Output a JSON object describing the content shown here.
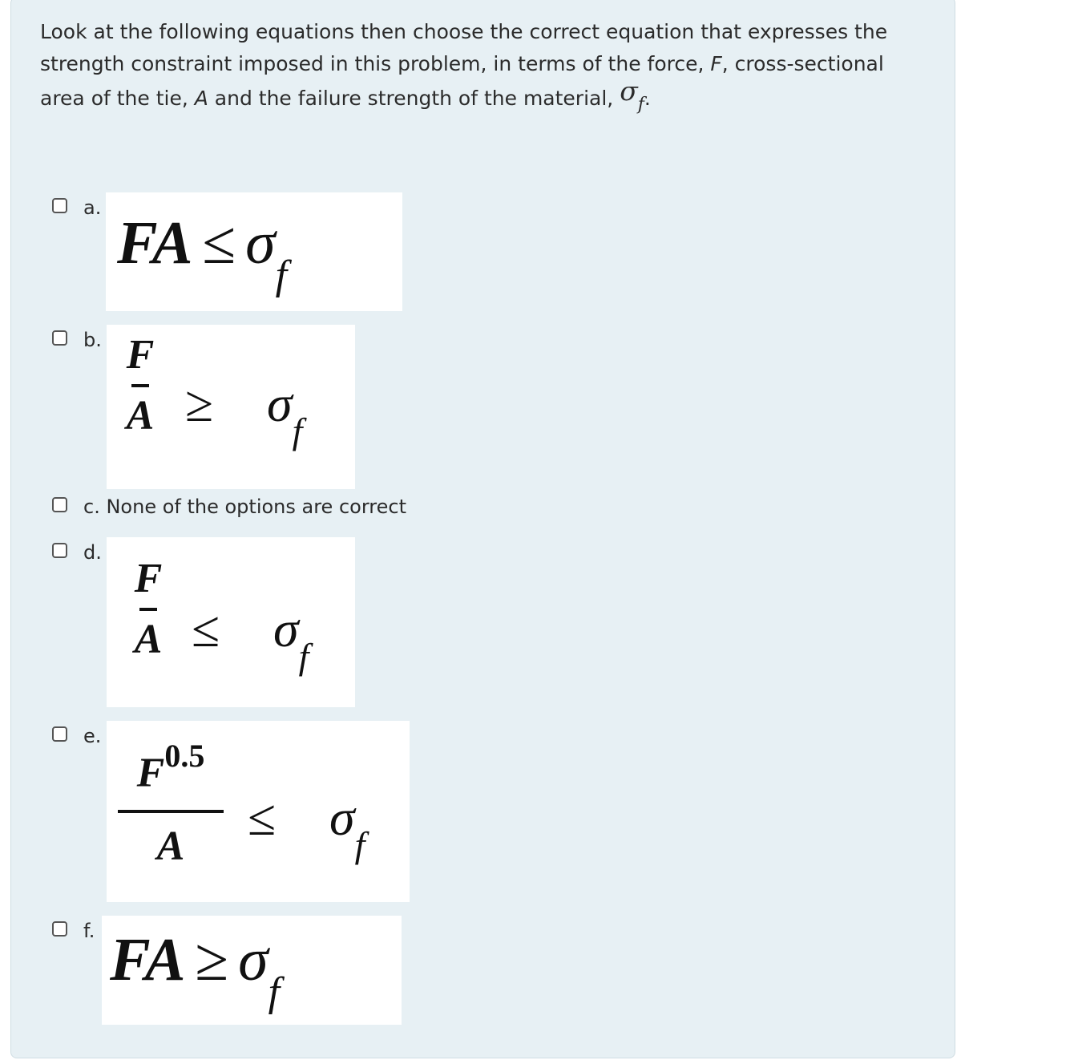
{
  "question": {
    "part1": "Look at the following equations then choose the correct equation that expresses the strength constraint imposed in this problem, in terms of the force, ",
    "F": "F",
    "part2": ", cross-sectional area of the tie, ",
    "A": "A",
    "part3": " and the failure strength of the material, ",
    "sigma": "σ",
    "sigma_sub": "f",
    "part4": "."
  },
  "options": [
    {
      "letter": "a.",
      "lhs": "FA",
      "rel": "≤",
      "sigma": "σ",
      "sub": "f"
    },
    {
      "letter": "b.",
      "num": "F",
      "den": "A",
      "rel": "≥",
      "sigma": "σ",
      "sub": "f"
    },
    {
      "letter": "c.",
      "text": "None of the options are correct"
    },
    {
      "letter": "d.",
      "num": "F",
      "den": "A",
      "rel": "≤",
      "sigma": "σ",
      "sub": "f"
    },
    {
      "letter": "e.",
      "num": "F",
      "num_exp": "0.5",
      "den": "A",
      "rel": "≤",
      "sigma": "σ",
      "sub": "f"
    },
    {
      "letter": "f.",
      "lhs": "FA",
      "rel": "≥",
      "sigma": "σ",
      "sub": "f"
    }
  ]
}
